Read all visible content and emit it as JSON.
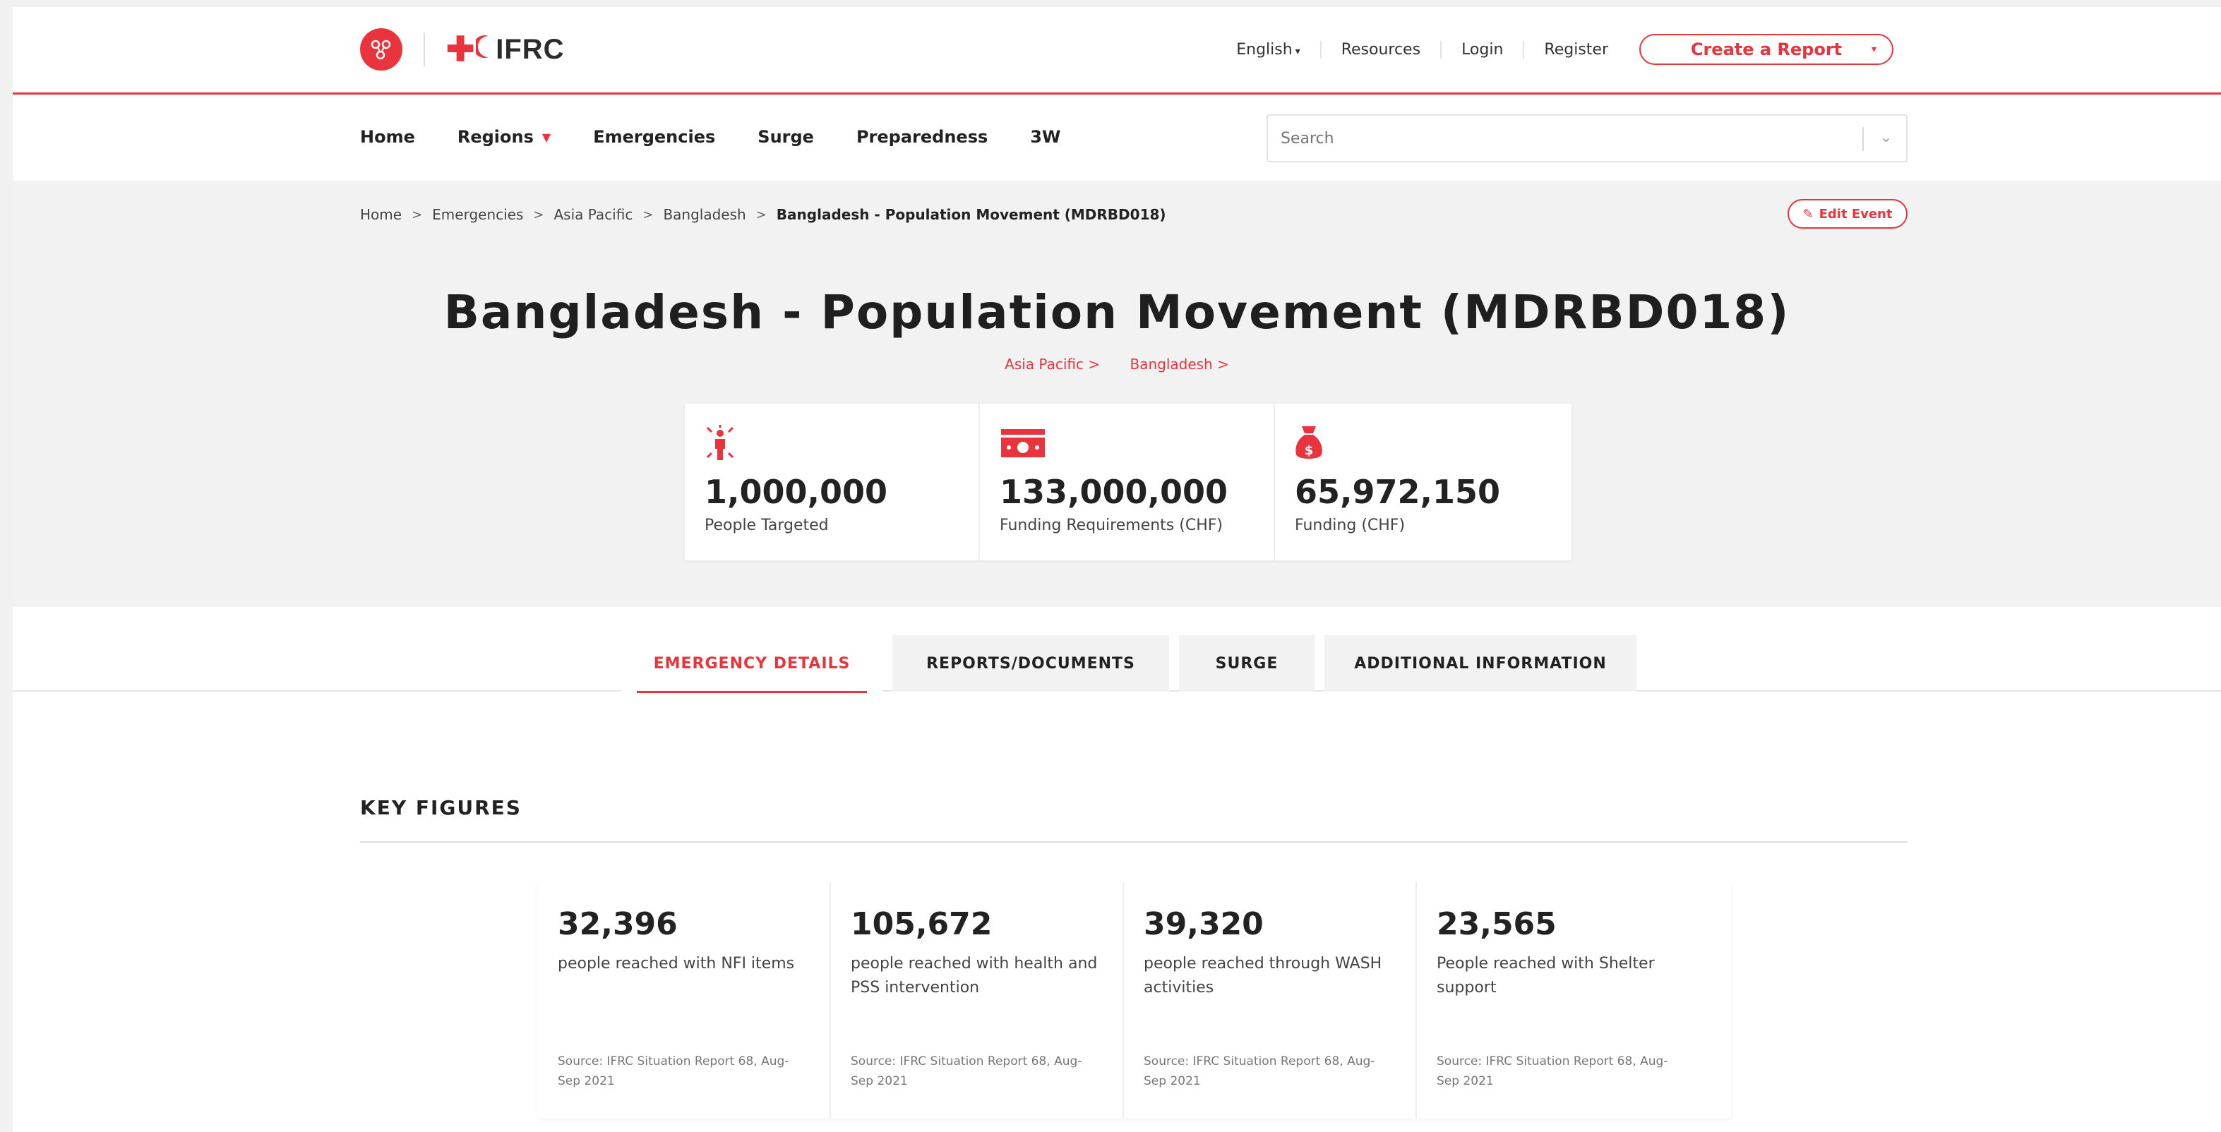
{
  "header": {
    "brand_name": "IFRC",
    "language": "English",
    "resources": "Resources",
    "login": "Login",
    "register": "Register",
    "create_report": "Create a Report"
  },
  "nav": {
    "items": [
      "Home",
      "Regions",
      "Emergencies",
      "Surge",
      "Preparedness",
      "3W"
    ],
    "search_placeholder": "Search"
  },
  "breadcrumb": [
    "Home",
    "Emergencies",
    "Asia Pacific",
    "Bangladesh",
    "Bangladesh - Population Movement (MDRBD018)"
  ],
  "edit_event": "Edit Event",
  "event": {
    "title": "Bangladesh - Population Movement (MDRBD018)",
    "region_link": "Asia Pacific >",
    "country_link": "Bangladesh >"
  },
  "stats": [
    {
      "value": "1,000,000",
      "label": "People Targeted",
      "icon": "person-targeted-icon"
    },
    {
      "value": "133,000,000",
      "label": "Funding Requirements (CHF)",
      "icon": "banknote-icon"
    },
    {
      "value": "65,972,150",
      "label": "Funding (CHF)",
      "icon": "money-bag-icon"
    }
  ],
  "tabs": [
    "EMERGENCY DETAILS",
    "REPORTS/DOCUMENTS",
    "SURGE",
    "ADDITIONAL INFORMATION"
  ],
  "key_figures": {
    "title": "KEY FIGURES",
    "items": [
      {
        "value": "32,396",
        "desc": "people reached with NFI items",
        "source": "Source: IFRC Situation Report 68, Aug-Sep 2021"
      },
      {
        "value": "105,672",
        "desc": "people reached with health and PSS intervention",
        "source": "Source: IFRC Situation Report 68, Aug-Sep 2021"
      },
      {
        "value": "39,320",
        "desc": "people reached through WASH activities",
        "source": "Source: IFRC Situation Report 68, Aug-Sep 2021"
      },
      {
        "value": "23,565",
        "desc": "People reached with Shelter support",
        "source": "Source: IFRC Situation Report 68, Aug-Sep 2021"
      }
    ]
  },
  "colors": {
    "accent": "#e8353d",
    "hero_bg": "#f2f2f2",
    "text": "#2b2b2b"
  }
}
